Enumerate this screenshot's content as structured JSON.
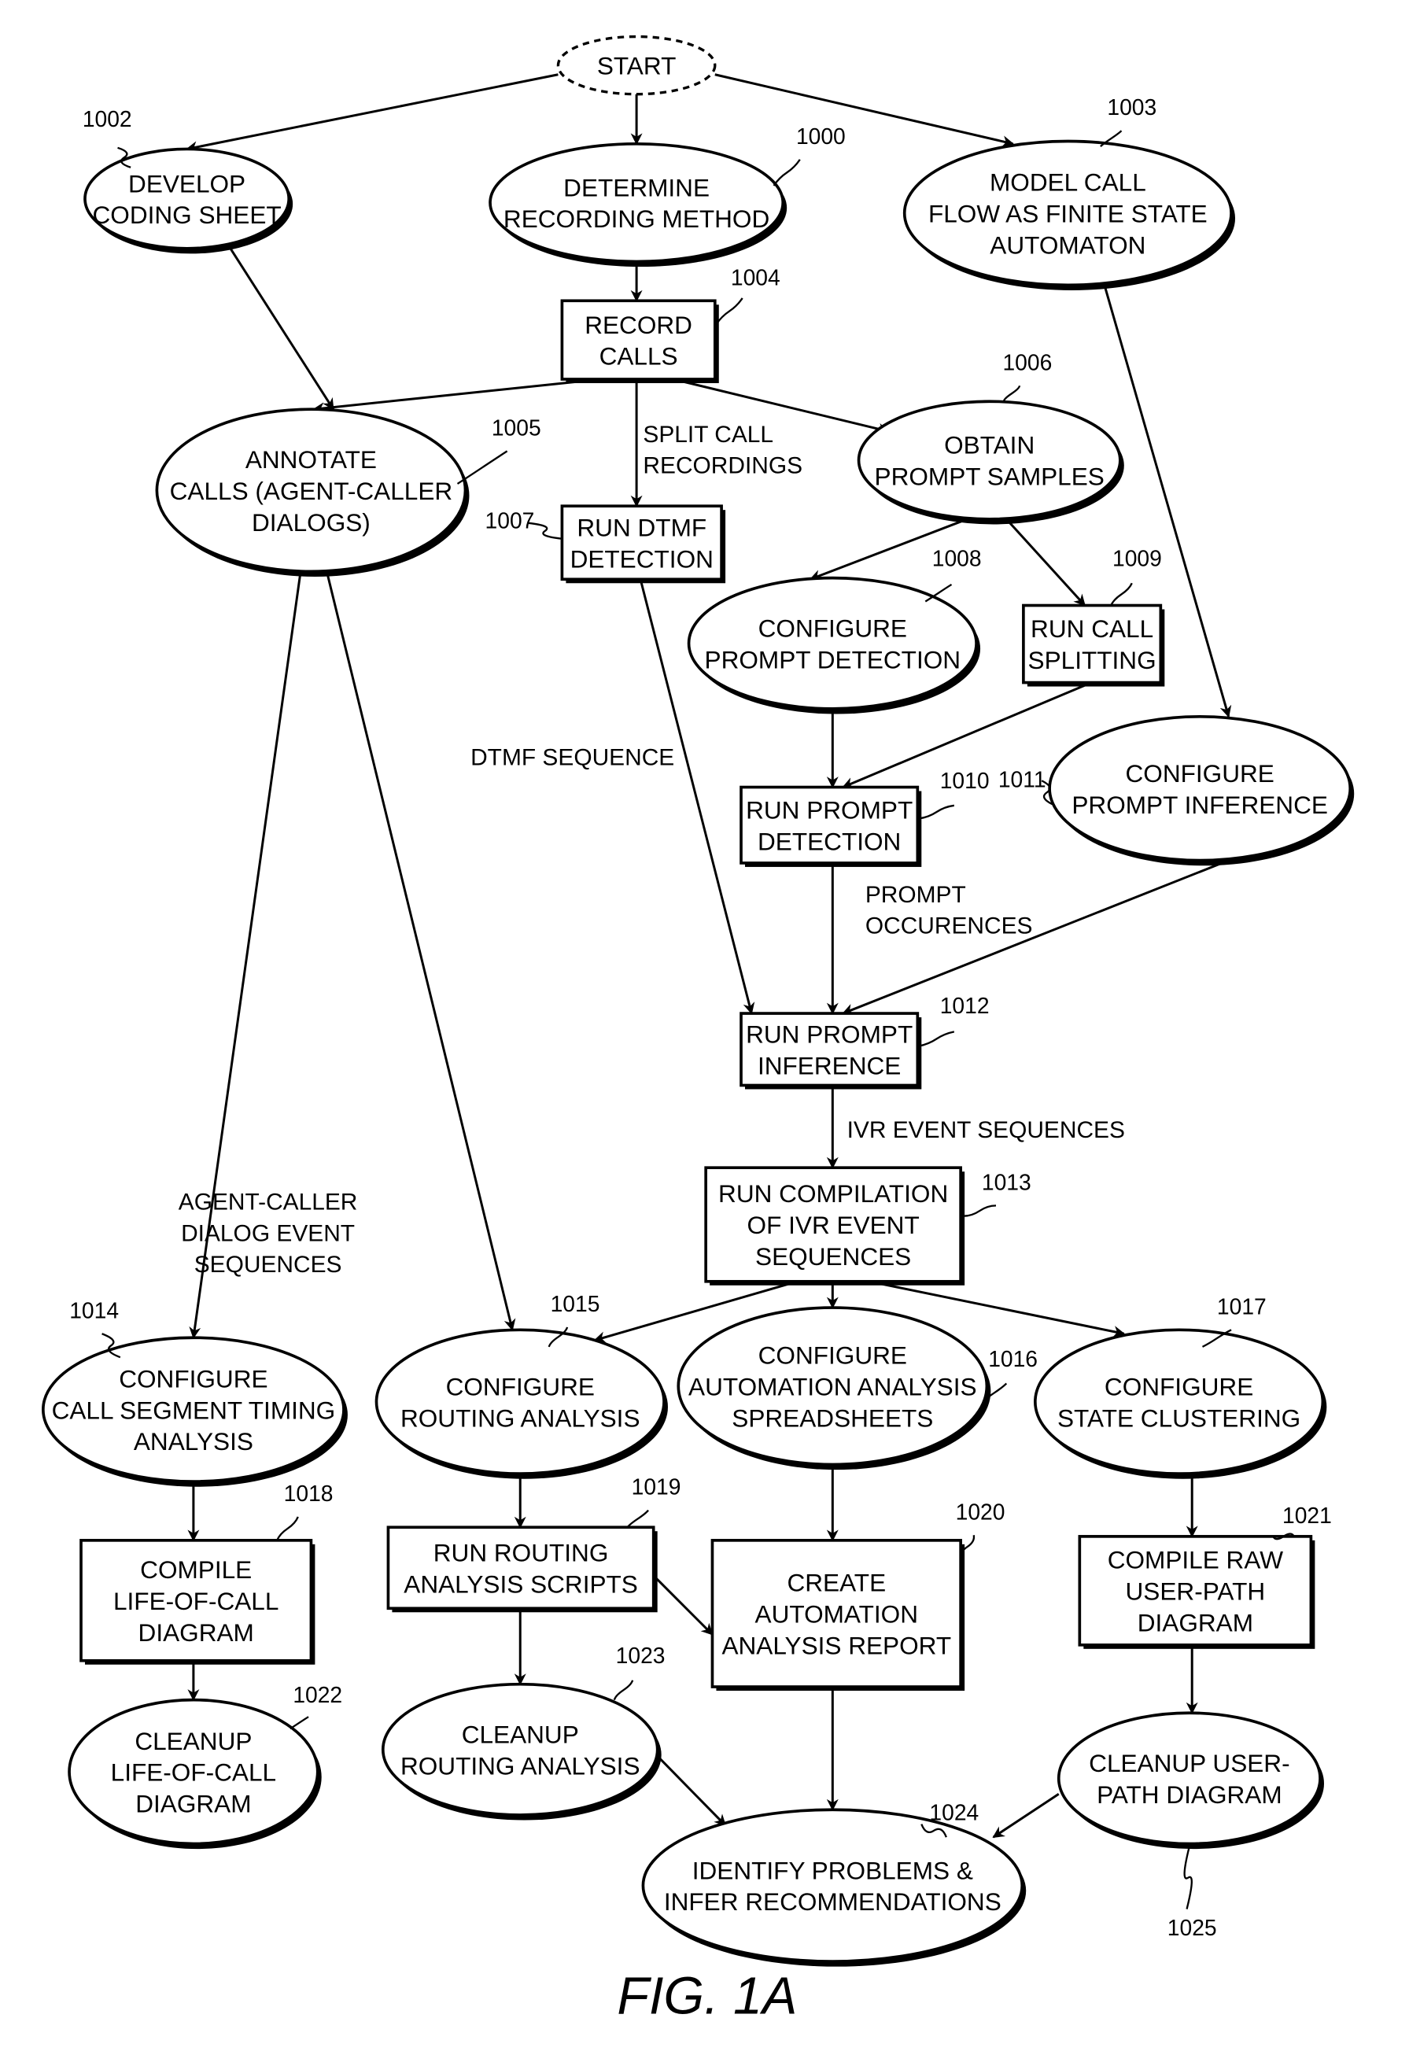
{
  "figure": {
    "caption": "FIG. 1A",
    "start_label": "START"
  },
  "nodes": [
    {
      "id": "1000",
      "ref": "1000",
      "shape": "ellipse",
      "lines": [
        "DETERMINE",
        "RECORDING METHOD"
      ]
    },
    {
      "id": "1002",
      "ref": "1002",
      "shape": "ellipse",
      "lines": [
        "DEVELOP",
        "CODING SHEET"
      ]
    },
    {
      "id": "1003",
      "ref": "1003",
      "shape": "ellipse",
      "lines": [
        "MODEL CALL",
        "FLOW AS FINITE  STATE",
        "AUTOMATON"
      ]
    },
    {
      "id": "1004",
      "ref": "1004",
      "shape": "box",
      "lines": [
        "RECORD",
        "CALLS"
      ]
    },
    {
      "id": "1005",
      "ref": "1005",
      "shape": "ellipse",
      "lines": [
        "ANNOTATE",
        "CALLS (AGENT-CALLER",
        "DIALOGS)"
      ]
    },
    {
      "id": "1006",
      "ref": "1006",
      "shape": "ellipse",
      "lines": [
        "OBTAIN",
        "PROMPT SAMPLES"
      ]
    },
    {
      "id": "1007",
      "ref": "1007",
      "shape": "box",
      "lines": [
        "RUN DTMF",
        "DETECTION"
      ]
    },
    {
      "id": "1008",
      "ref": "1008",
      "shape": "ellipse",
      "lines": [
        "CONFIGURE",
        "PROMPT DETECTION"
      ]
    },
    {
      "id": "1009",
      "ref": "1009",
      "shape": "box",
      "lines": [
        "RUN CALL",
        "SPLITTING"
      ]
    },
    {
      "id": "1010",
      "ref": "1010",
      "shape": "box",
      "lines": [
        "RUN PROMPT",
        "DETECTION"
      ]
    },
    {
      "id": "1011",
      "ref": "1011",
      "shape": "ellipse",
      "lines": [
        "CONFIGURE",
        "PROMPT INFERENCE"
      ]
    },
    {
      "id": "1012",
      "ref": "1012",
      "shape": "box",
      "lines": [
        "RUN PROMPT",
        "INFERENCE"
      ]
    },
    {
      "id": "1013",
      "ref": "1013",
      "shape": "box",
      "lines": [
        "RUN COMPILATION",
        "OF IVR EVENT",
        "SEQUENCES"
      ]
    },
    {
      "id": "1014",
      "ref": "1014",
      "shape": "ellipse",
      "lines": [
        "CONFIGURE",
        "CALL SEGMENT TIMING",
        "ANALYSIS"
      ]
    },
    {
      "id": "1015",
      "ref": "1015",
      "shape": "ellipse",
      "lines": [
        "CONFIGURE",
        "ROUTING ANALYSIS"
      ]
    },
    {
      "id": "1016",
      "ref": "1016",
      "shape": "ellipse",
      "lines": [
        "CONFIGURE",
        "AUTOMATION ANALYSIS",
        "SPREADSHEETS"
      ]
    },
    {
      "id": "1017",
      "ref": "1017",
      "shape": "ellipse",
      "lines": [
        "CONFIGURE",
        "STATE CLUSTERING"
      ]
    },
    {
      "id": "1018",
      "ref": "1018",
      "shape": "box",
      "lines": [
        "COMPILE",
        "LIFE-OF-CALL",
        "DIAGRAM"
      ]
    },
    {
      "id": "1019",
      "ref": "1019",
      "shape": "box",
      "lines": [
        "RUN ROUTING",
        "ANALYSIS SCRIPTS"
      ]
    },
    {
      "id": "1020",
      "ref": "1020",
      "shape": "box",
      "lines": [
        "CREATE",
        "AUTOMATION",
        "ANALYSIS REPORT"
      ]
    },
    {
      "id": "1021",
      "ref": "1021",
      "shape": "box",
      "lines": [
        "COMPILE RAW",
        "USER-PATH",
        "DIAGRAM"
      ]
    },
    {
      "id": "1022",
      "ref": "1022",
      "shape": "ellipse",
      "lines": [
        "CLEANUP",
        "LIFE-OF-CALL",
        "DIAGRAM"
      ]
    },
    {
      "id": "1023",
      "ref": "1023",
      "shape": "ellipse",
      "lines": [
        "CLEANUP",
        "ROUTING ANALYSIS"
      ]
    },
    {
      "id": "1024",
      "ref": "1024",
      "shape": "ellipse",
      "lines": [
        "IDENTIFY PROBLEMS &",
        "INFER RECOMMENDATIONS"
      ]
    },
    {
      "id": "1025",
      "ref": "1025",
      "shape": "ellipse",
      "lines": [
        "CLEANUP USER-",
        "PATH DIAGRAM"
      ]
    }
  ],
  "edges": [
    {
      "from": "start",
      "to": "1002"
    },
    {
      "from": "start",
      "to": "1000"
    },
    {
      "from": "start",
      "to": "1003"
    },
    {
      "from": "1000",
      "to": "1004"
    },
    {
      "from": "1002",
      "to": "1005"
    },
    {
      "from": "1004",
      "to": "1005"
    },
    {
      "from": "1004",
      "to": "1007",
      "label": [
        "SPLIT CALL",
        "RECORDINGS"
      ]
    },
    {
      "from": "1004",
      "to": "1006"
    },
    {
      "from": "1006",
      "to": "1008"
    },
    {
      "from": "1006",
      "to": "1009"
    },
    {
      "from": "1003",
      "to": "1011"
    },
    {
      "from": "1008",
      "to": "1010"
    },
    {
      "from": "1009",
      "to": "1010"
    },
    {
      "from": "1007",
      "to": "1012",
      "label": [
        "DTMF SEQUENCE"
      ]
    },
    {
      "from": "1010",
      "to": "1012",
      "label": [
        "PROMPT",
        "OCCURENCES"
      ]
    },
    {
      "from": "1011",
      "to": "1012"
    },
    {
      "from": "1012",
      "to": "1013",
      "label": [
        "IVR EVENT SEQUENCES"
      ]
    },
    {
      "from": "1005",
      "to": "1014"
    },
    {
      "from": "1005",
      "to": "1015",
      "label": [
        "AGENT-CALLER",
        "DIALOG EVENT",
        "SEQUENCES"
      ]
    },
    {
      "from": "1013",
      "to": "1015"
    },
    {
      "from": "1013",
      "to": "1016"
    },
    {
      "from": "1013",
      "to": "1017"
    },
    {
      "from": "1014",
      "to": "1018"
    },
    {
      "from": "1015",
      "to": "1019"
    },
    {
      "from": "1016",
      "to": "1020"
    },
    {
      "from": "1019",
      "to": "1020"
    },
    {
      "from": "1017",
      "to": "1021"
    },
    {
      "from": "1018",
      "to": "1022"
    },
    {
      "from": "1019",
      "to": "1023"
    },
    {
      "from": "1021",
      "to": "1025"
    },
    {
      "from": "1023",
      "to": "1024"
    },
    {
      "from": "1020",
      "to": "1024"
    },
    {
      "from": "1025",
      "to": "1024"
    }
  ]
}
